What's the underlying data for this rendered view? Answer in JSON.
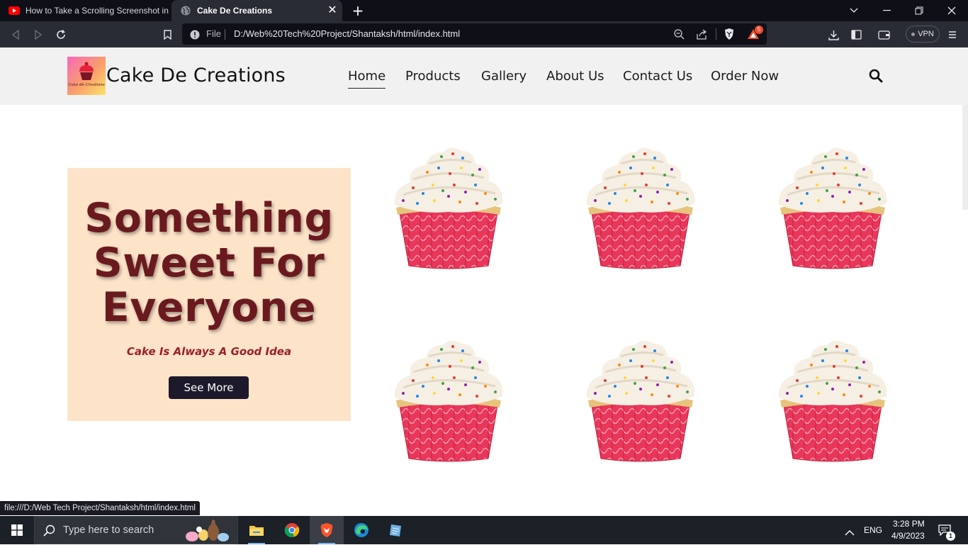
{
  "browser": {
    "tabs": [
      {
        "title": "How to Take a Scrolling Screenshot in",
        "icon": "youtube-icon",
        "active": false
      },
      {
        "title": "Cake De Creations",
        "icon": "globe-icon",
        "active": true
      }
    ],
    "address_scheme": "File",
    "address_url": "D:/Web%20Tech%20Project/Shantaksh/html/index.html",
    "brave_rewards_count": "5",
    "vpn_label": "VPN",
    "status_url": "file:///D:/Web Tech Project/Shantaksh/html/index.html"
  },
  "site": {
    "brand": "Cake De Creations",
    "logo_text": "Cake de Creations",
    "nav": [
      {
        "label": "Home",
        "active": true
      },
      {
        "label": "Products",
        "active": false
      },
      {
        "label": "Gallery",
        "active": false
      },
      {
        "label": "About Us",
        "active": false
      },
      {
        "label": "Contact Us",
        "active": false
      },
      {
        "label": "Order Now",
        "active": false
      }
    ],
    "hero": {
      "title_line1": "Something",
      "title_line2": "Sweet For",
      "title_line3": "Everyone",
      "tagline": "Cake Is Always A Good Idea",
      "button": "See More"
    },
    "gallery_item_count": 6
  },
  "taskbar": {
    "search_placeholder": "Type here to search",
    "language": "ENG",
    "time": "3:28 PM",
    "date": "4/9/2023",
    "notification_count": "1"
  },
  "colors": {
    "hero_bg": "#fde4c9",
    "hero_title": "#6a1a1e",
    "tagline": "#9a1f2a",
    "button_bg": "#1c1a2a",
    "header_bg": "#f1f1f1"
  }
}
